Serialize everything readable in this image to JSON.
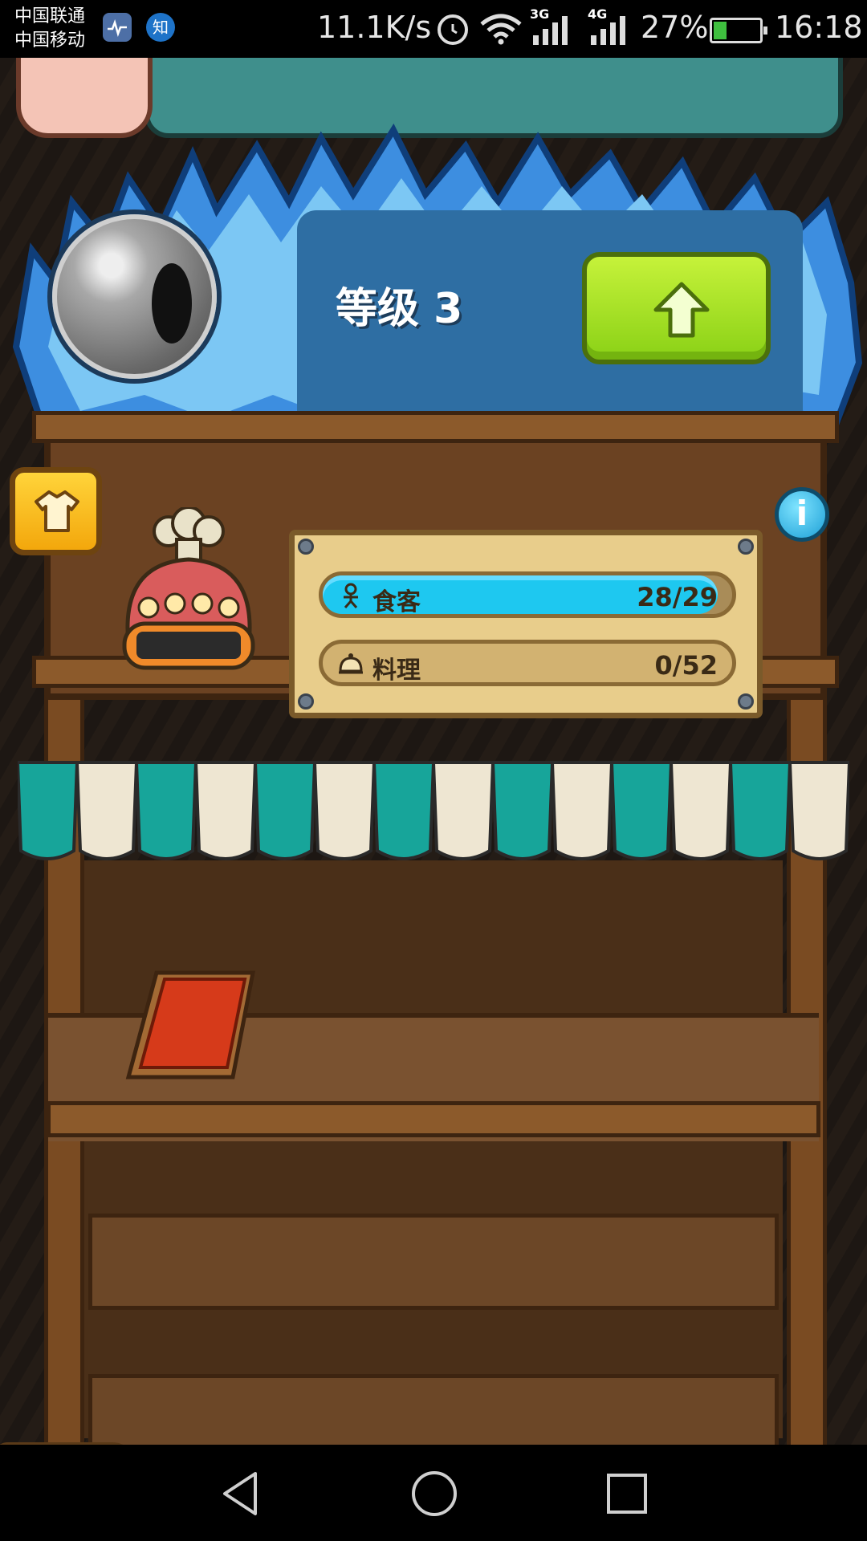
{
  "status_bar": {
    "carrier_1": "中国联通",
    "carrier_2": "中国移动",
    "app_icons": [
      "health-icon",
      "zhihu-icon"
    ],
    "zhihu_glyph": "知",
    "net_speed": "11.1K/s",
    "net_3g": "3G",
    "net_4g": "4G",
    "battery_percent": "27%",
    "battery_level": 0.27,
    "time": "16:18"
  },
  "game": {
    "level": {
      "label": "等级 3"
    },
    "upgrade_button": {
      "icon": "up-arrow-icon"
    },
    "outfit_button": {
      "icon": "shirt-icon"
    },
    "info_button": {
      "glyph": "i"
    },
    "stats": {
      "diners": {
        "label": "食客",
        "value": "28/29",
        "current": 28,
        "max": 29
      },
      "dishes": {
        "label": "料理",
        "value": "0/52",
        "current": 0,
        "max": 52
      }
    },
    "colors": {
      "upgrade_green": "#9ad91f",
      "diners_bar": "#1ec8f0",
      "panel_blue": "#2e6ea3"
    }
  },
  "nav_bar": {
    "back": "back-icon",
    "home": "home-icon",
    "recent": "recent-apps-icon"
  }
}
